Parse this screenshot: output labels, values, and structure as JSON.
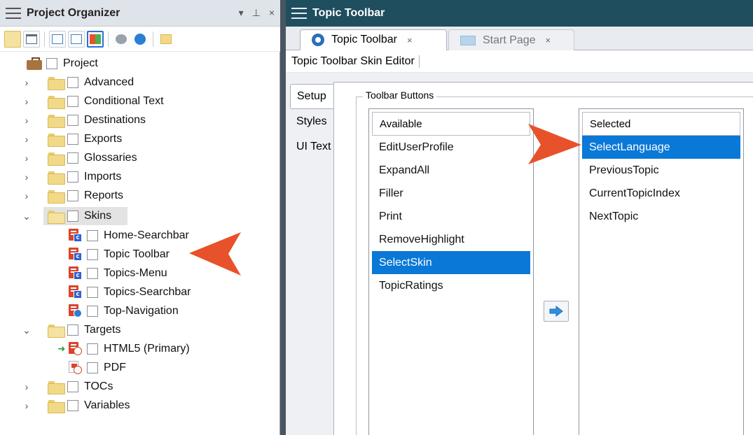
{
  "organizer": {
    "title": "Project Organizer",
    "controls": {
      "dropdown": "▾",
      "pin": "⊥",
      "close": "×"
    },
    "tree": [
      {
        "label": "Project",
        "icon": "briefcase-icon"
      },
      {
        "label": "Advanced",
        "icon": "folder-icon"
      },
      {
        "label": "Conditional Text",
        "icon": "folder-icon"
      },
      {
        "label": "Destinations",
        "icon": "folder-icon"
      },
      {
        "label": "Exports",
        "icon": "folder-icon"
      },
      {
        "label": "Glossaries",
        "icon": "folder-icon"
      },
      {
        "label": "Imports",
        "icon": "folder-icon"
      },
      {
        "label": "Reports",
        "icon": "folder-icon"
      },
      {
        "label": "Skins",
        "icon": "folder-open-icon",
        "expanded": true
      },
      {
        "label": "Home-Searchbar",
        "icon": "skin-icon"
      },
      {
        "label": "Topic Toolbar",
        "icon": "skin-icon"
      },
      {
        "label": "Topics-Menu",
        "icon": "skin-icon"
      },
      {
        "label": "Topics-Searchbar",
        "icon": "skin-icon"
      },
      {
        "label": "Top-Navigation",
        "icon": "skin-icon"
      },
      {
        "label": "Targets",
        "icon": "folder-open-icon",
        "expanded": true
      },
      {
        "label": "HTML5 (Primary)",
        "icon": "target-icon"
      },
      {
        "label": "PDF",
        "icon": "pdf-icon"
      },
      {
        "label": "TOCs",
        "icon": "folder-icon"
      },
      {
        "label": "Variables",
        "icon": "folder-icon"
      }
    ]
  },
  "editor": {
    "title": "Topic Toolbar",
    "tabs": [
      {
        "label": "Topic Toolbar",
        "close": "×",
        "active": true
      },
      {
        "label": "Start Page",
        "close": "×",
        "active": false
      }
    ],
    "subheader": "Topic Toolbar Skin Editor",
    "side_tabs": [
      "Setup",
      "Styles",
      "UI Text"
    ],
    "group_label": "Toolbar Buttons",
    "available": {
      "header": "Available",
      "items": [
        "EditUserProfile",
        "ExpandAll",
        "Filler",
        "Print",
        "RemoveHighlight",
        "SelectSkin",
        "TopicRatings"
      ],
      "selected_item": "SelectSkin"
    },
    "selected": {
      "header": "Selected",
      "items": [
        "SelectLanguage",
        "PreviousTopic",
        "CurrentTopicIndex",
        "NextTopic"
      ],
      "selected_item": "SelectLanguage"
    }
  },
  "colors": {
    "editor_header": "#1f4e5f",
    "selection": "#0a78d7",
    "callout": "#e8522a"
  }
}
